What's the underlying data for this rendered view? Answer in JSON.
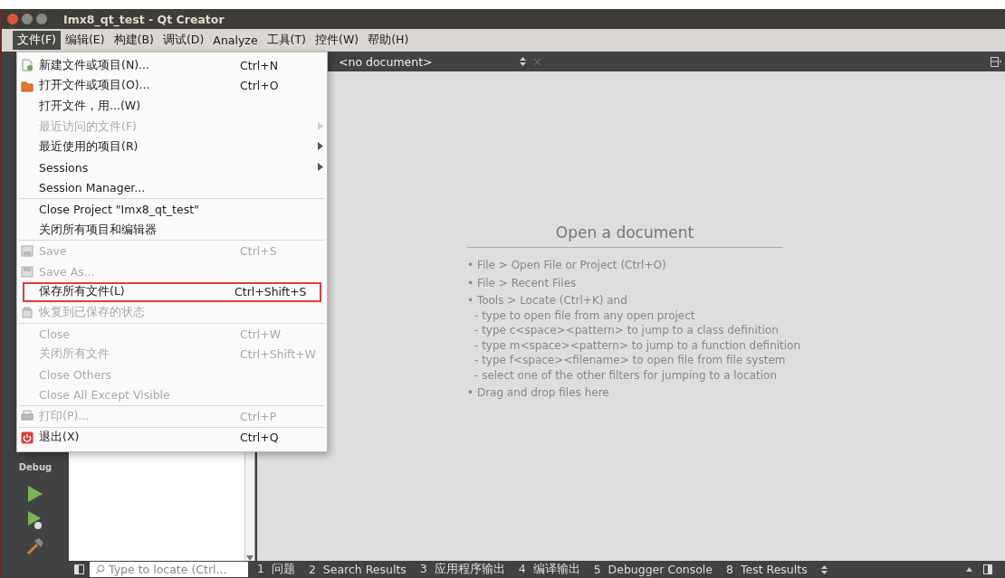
{
  "window": {
    "title": "Imx8_qt_test - Qt Creator"
  },
  "menubar": [
    {
      "label": "文件(F)",
      "selected": true
    },
    {
      "label": "编辑(E)",
      "selected": false
    },
    {
      "label": "构建(B)",
      "selected": false
    },
    {
      "label": "调试(D)",
      "selected": false
    },
    {
      "label": "Analyze",
      "selected": false
    },
    {
      "label": "工具(T)",
      "selected": false
    },
    {
      "label": "控件(W)",
      "selected": false
    },
    {
      "label": "帮助(H)",
      "selected": false
    }
  ],
  "file_menu": [
    {
      "kind": "item",
      "label": "新建文件或项目(N)...",
      "shortcut": "Ctrl+N",
      "disabled": false,
      "submenu": false,
      "highlighted": false
    },
    {
      "kind": "item",
      "label": "打开文件或项目(O)...",
      "shortcut": "Ctrl+O",
      "disabled": false,
      "submenu": false,
      "highlighted": false
    },
    {
      "kind": "item",
      "label": "打开文件，用...(W)",
      "disabled": false,
      "submenu": false,
      "highlighted": false
    },
    {
      "kind": "item",
      "label": "最近访问的文件(F)",
      "disabled": true,
      "submenu": true,
      "highlighted": false
    },
    {
      "kind": "item",
      "label": "最近使用的项目(R)",
      "disabled": false,
      "submenu": true,
      "highlighted": false
    },
    {
      "kind": "item",
      "label": "Sessions",
      "disabled": false,
      "submenu": true,
      "highlighted": false
    },
    {
      "kind": "item",
      "label": "Session Manager...",
      "disabled": false,
      "submenu": false,
      "highlighted": false
    },
    {
      "kind": "separator"
    },
    {
      "kind": "item",
      "label": "Close Project \"Imx8_qt_test\"",
      "disabled": false,
      "submenu": false,
      "highlighted": false
    },
    {
      "kind": "item",
      "label": "关闭所有项目和编辑器",
      "disabled": false,
      "submenu": false,
      "highlighted": false
    },
    {
      "kind": "separator"
    },
    {
      "kind": "item",
      "label": "Save",
      "shortcut": "Ctrl+S",
      "disabled": true,
      "submenu": false,
      "highlighted": false
    },
    {
      "kind": "item",
      "label": "Save As...",
      "disabled": true,
      "submenu": false,
      "highlighted": false
    },
    {
      "kind": "item",
      "label": "保存所有文件(L)",
      "shortcut": "Ctrl+Shift+S",
      "disabled": false,
      "submenu": false,
      "highlighted": true
    },
    {
      "kind": "item",
      "label": "恢复到已保存的状态",
      "disabled": true,
      "submenu": false,
      "highlighted": false
    },
    {
      "kind": "separator"
    },
    {
      "kind": "item",
      "label": "Close",
      "shortcut": "Ctrl+W",
      "disabled": true,
      "submenu": false,
      "highlighted": false
    },
    {
      "kind": "item",
      "label": "关闭所有文件",
      "shortcut": "Ctrl+Shift+W",
      "disabled": true,
      "submenu": false,
      "highlighted": false
    },
    {
      "kind": "item",
      "label": "Close Others",
      "disabled": true,
      "submenu": false,
      "highlighted": false
    },
    {
      "kind": "item",
      "label": "Close All Except Visible",
      "disabled": true,
      "submenu": false,
      "highlighted": false
    },
    {
      "kind": "separator"
    },
    {
      "kind": "item",
      "label": "打印(P)...",
      "shortcut": "Ctrl+P",
      "disabled": true,
      "submenu": false,
      "highlighted": false
    },
    {
      "kind": "separator"
    },
    {
      "kind": "item",
      "label": "退出(X)",
      "shortcut": "Ctrl+Q",
      "disabled": false,
      "submenu": false,
      "highlighted": false
    }
  ],
  "sidebar": {
    "mode_label": "Debug"
  },
  "editor": {
    "document_selector": "<no document>",
    "heading": "Open a document",
    "hints": [
      {
        "kind": "bullet",
        "text": "• File > Open File or Project (Ctrl+O)"
      },
      {
        "kind": "bullet",
        "text": "• File > Recent Files"
      },
      {
        "kind": "bullet",
        "text": "• Tools > Locate (Ctrl+K) and"
      },
      {
        "kind": "sub",
        "text": "- type to open file from any open project"
      },
      {
        "kind": "sub",
        "text": "- type c<space><pattern> to jump to a class definition"
      },
      {
        "kind": "sub",
        "text": "- type m<space><pattern> to jump to a function definition"
      },
      {
        "kind": "sub",
        "text": "- type f<space><filename> to open file from file system"
      },
      {
        "kind": "sub",
        "text": "- select one of the other filters for jumping to a location"
      },
      {
        "kind": "bullet",
        "text": "• Drag and drop files here"
      }
    ]
  },
  "status_bar": {
    "locate_placeholder": "Type to locate (Ctrl...",
    "panes": [
      "1  问题",
      "2  Search Results",
      "3  应用程序输出",
      "4  编译输出",
      "5  Debugger Console",
      "8  Test Results"
    ]
  }
}
